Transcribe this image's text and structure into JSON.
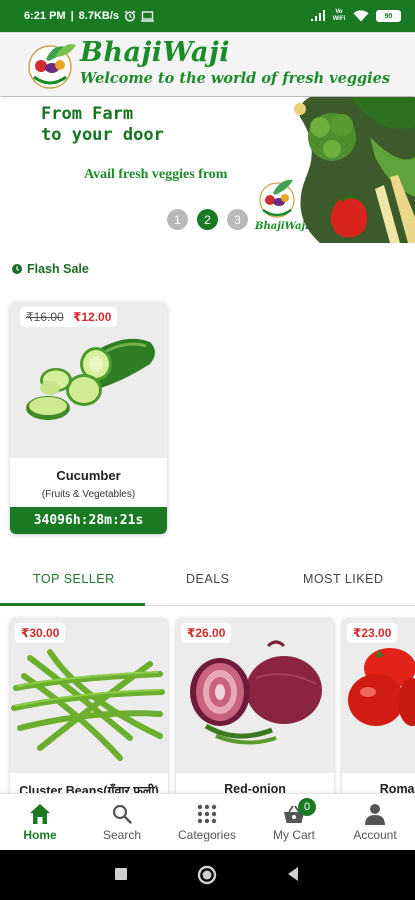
{
  "status_bar": {
    "time": "6:21 PM",
    "speed": "8.7KB/s",
    "vowifi": "Vo WiFi",
    "battery": "90"
  },
  "header": {
    "brand": "BhajiWaji",
    "tagline": "Welcome to the world of fresh veggies"
  },
  "banner": {
    "title": "From Farm\nto your door",
    "subtitle": "Avail fresh veggies from",
    "logo_text": "BhajiWaji",
    "pages": [
      "1",
      "2",
      "3"
    ],
    "active_page": 2
  },
  "flash_sale": {
    "title": "Flash Sale",
    "card": {
      "old_price": "₹16.00",
      "price": "₹12.00",
      "name": "Cucumber",
      "category": "(Fruits & Vegetables)",
      "timer": "34096h:28m:21s"
    }
  },
  "tabs": [
    {
      "label": "TOP SELLER",
      "active": true
    },
    {
      "label": "DEALS",
      "active": false
    },
    {
      "label": "MOST LIKED",
      "active": false
    }
  ],
  "products": [
    {
      "price": "₹30.00",
      "name": "Cluster Beans(गँवार फली)"
    },
    {
      "price": "₹26.00",
      "name": "Red-onion"
    },
    {
      "price": "₹23.00",
      "name": "Roma Tomato"
    }
  ],
  "bottom_nav": {
    "items": [
      {
        "label": "Home",
        "icon": "home-icon",
        "active": true
      },
      {
        "label": "Search",
        "icon": "search-icon",
        "active": false
      },
      {
        "label": "Categories",
        "icon": "grid-icon",
        "active": false
      },
      {
        "label": "My Cart",
        "icon": "basket-icon",
        "active": false
      },
      {
        "label": "Account",
        "icon": "person-icon",
        "active": false
      }
    ],
    "cart_count": "0"
  },
  "colors": {
    "brand_green": "#1a7a24",
    "sale_red": "#d12b2b"
  }
}
